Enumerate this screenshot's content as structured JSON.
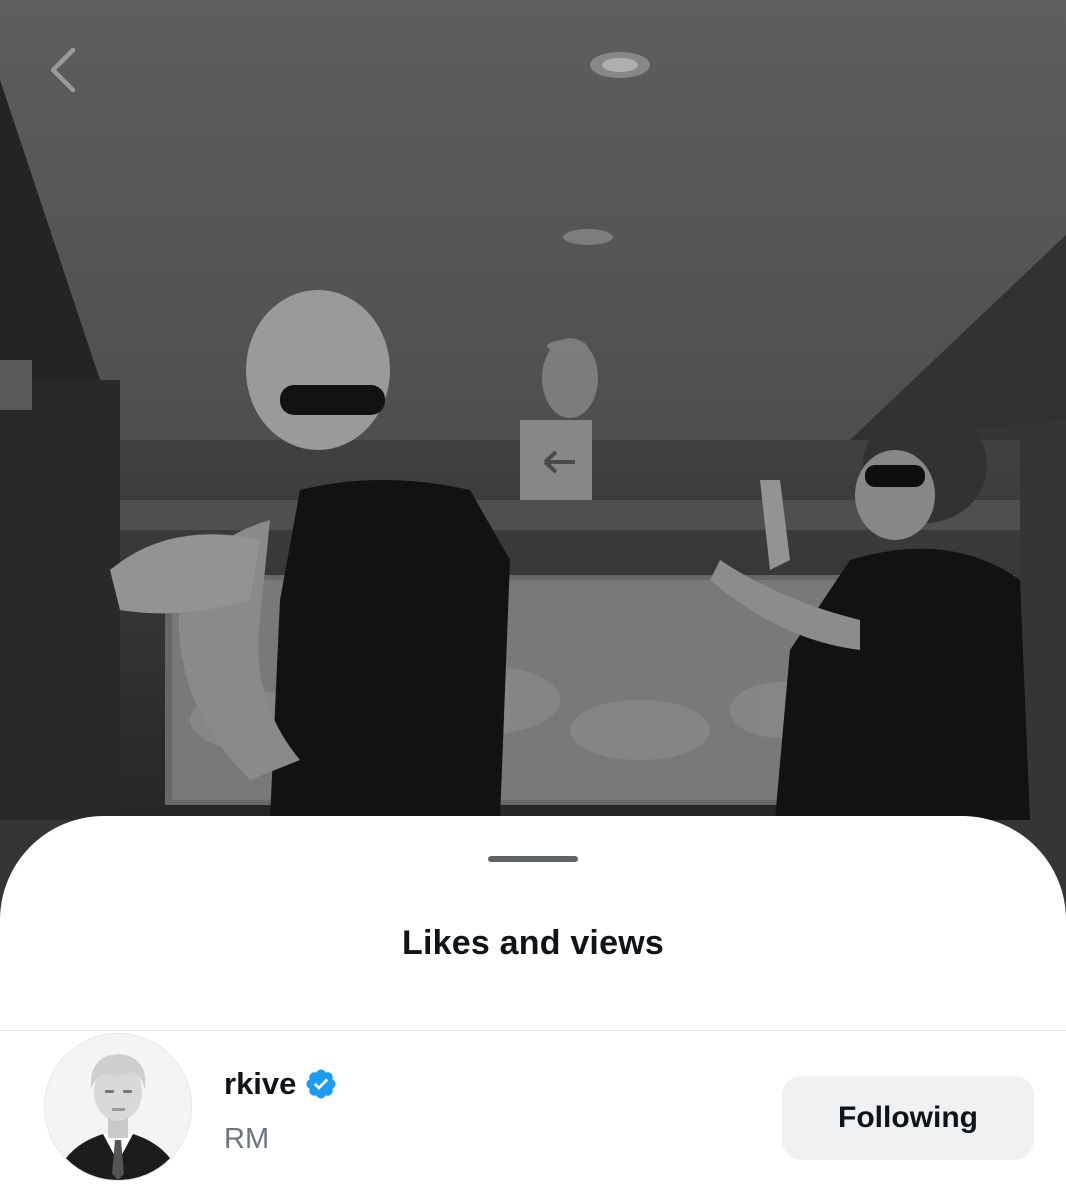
{
  "sheet": {
    "title": "Likes and views"
  },
  "user": {
    "username": "rkive",
    "display_name": "RM",
    "verified": true,
    "follow_label": "Following"
  },
  "icons": {
    "back": "chevron-left-icon",
    "verified": "verified-badge-icon"
  },
  "colors": {
    "verified_blue": "#1d9bf0",
    "button_bg": "#eff1f3",
    "text_primary": "#0f1419",
    "text_secondary": "#6b7681"
  }
}
